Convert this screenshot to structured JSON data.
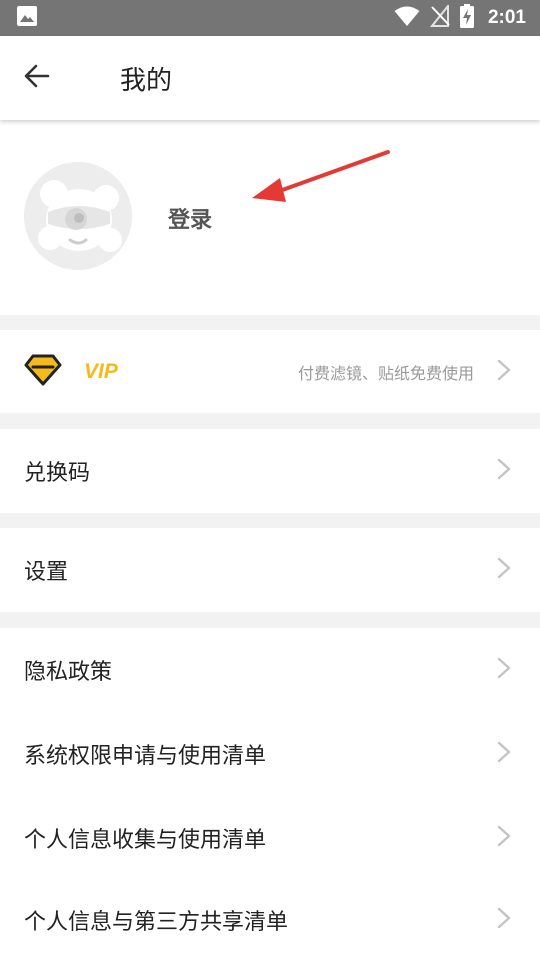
{
  "status_bar": {
    "time": "2:01",
    "icons": [
      "image-icon",
      "wifi-icon",
      "no-sim-icon",
      "battery-charging-icon"
    ]
  },
  "header": {
    "title": "我的",
    "back_icon": "arrow-left-icon"
  },
  "profile": {
    "login_label": "登录",
    "avatar_icon": "default-avatar-icon"
  },
  "vip": {
    "label": "VIP",
    "subtitle": "付费滤镜、贴纸免费使用",
    "icon": "diamond-icon",
    "accent_color": "#f5b91a"
  },
  "menu": {
    "redeem": "兑换码",
    "settings": "设置",
    "privacy": "隐私政策",
    "permissions": "系统权限申请与使用清单",
    "info_collection": "个人信息收集与使用清单",
    "third_party": "个人信息与第三方共享清单"
  },
  "colors": {
    "status_bar": "#757575",
    "divider": "#f2f2f2",
    "annotation_arrow": "#e53935"
  }
}
